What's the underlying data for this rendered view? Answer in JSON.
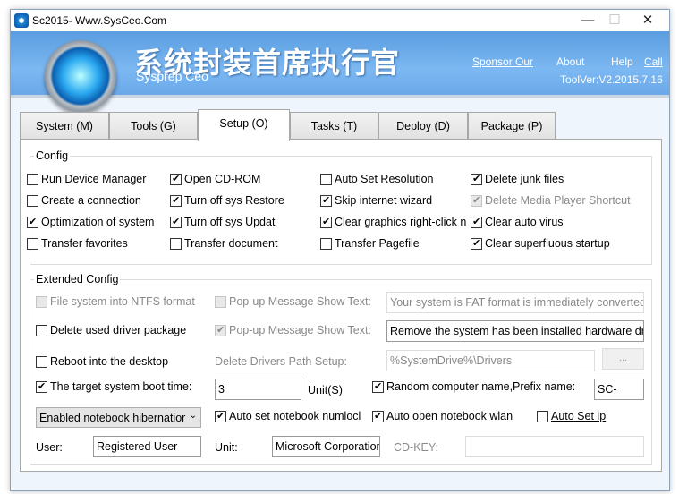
{
  "window": {
    "title": "Sc2015- Www.SysCeo.Com",
    "minimize": "—",
    "maximize": "☐",
    "close": "✕"
  },
  "banner": {
    "cn_title": "系统封装首席执行官",
    "en_title": "Sysprep  Ceo",
    "sponsor": "Sponsor Our",
    "about": "About",
    "help": "Help",
    "call": "Call",
    "version": "ToolVer:V2.2015.7.16"
  },
  "tabs": [
    "System (M)",
    "Tools (G)",
    "Setup (O)",
    "Tasks (T)",
    "Deploy (D)",
    "Package (P)"
  ],
  "active_tab": "Setup (O)",
  "config": {
    "label": "Config",
    "items": [
      {
        "label": "Run Device Manager",
        "checked": false
      },
      {
        "label": "Open CD-ROM",
        "checked": true
      },
      {
        "label": "Auto Set Resolution",
        "checked": false
      },
      {
        "label": "Delete junk files",
        "checked": true
      },
      {
        "label": "Create a connection",
        "checked": false
      },
      {
        "label": "Turn off sys Restore",
        "checked": true
      },
      {
        "label": "Skip internet wizard",
        "checked": true
      },
      {
        "label": "Delete Media Player Shortcut",
        "checked": true,
        "disabled": true
      },
      {
        "label": "Optimization of system",
        "checked": true
      },
      {
        "label": "Turn off sys Updat",
        "checked": true
      },
      {
        "label": "Clear graphics right-click n",
        "checked": true
      },
      {
        "label": "Clear auto virus",
        "checked": true
      },
      {
        "label": "Transfer favorites",
        "checked": false
      },
      {
        "label": "Transfer document",
        "checked": false
      },
      {
        "label": "Transfer Pagefile",
        "checked": false
      },
      {
        "label": "Clear superfluous startup",
        "checked": true
      }
    ]
  },
  "extended": {
    "label": "Extended Config",
    "ntfs": {
      "label": "File system into NTFS format",
      "checked": false
    },
    "popup1": {
      "label": "Pop-up Message Show Text:",
      "checked": false,
      "value": "Your system is FAT format is immediately converted t"
    },
    "delete_driver": {
      "label": "Delete used driver package",
      "checked": false
    },
    "popup2": {
      "label": "Pop-up Message Show Text:",
      "checked": true,
      "value": "Remove the system has been installed hardware dr"
    },
    "reboot": {
      "label": "Reboot into the desktop",
      "checked": false
    },
    "drivers_path_label": "Delete Drivers Path Setup:",
    "drivers_path": "%SystemDrive%\\Drivers",
    "browse": "...",
    "boot_time": {
      "label": "The target system boot time:",
      "checked": true,
      "value": "3",
      "unit": "Unit(S)"
    },
    "random_name": {
      "label": "Random computer name,Prefix name:",
      "checked": true,
      "value": "SC-"
    },
    "hibernation": "Enabled notebook hibernatior",
    "numlock": {
      "label": "Auto set notebook numlocl",
      "checked": true
    },
    "wlan": {
      "label": "Auto open notebook wlan",
      "checked": true
    },
    "auto_ip": {
      "label": "Auto Set ip",
      "checked": false
    },
    "user_label": "User:",
    "user": "Registered User",
    "unit_label": "Unit:",
    "unit": "Microsoft Corporation",
    "cdkey_label": "CD-KEY:",
    "cdkey": ""
  }
}
